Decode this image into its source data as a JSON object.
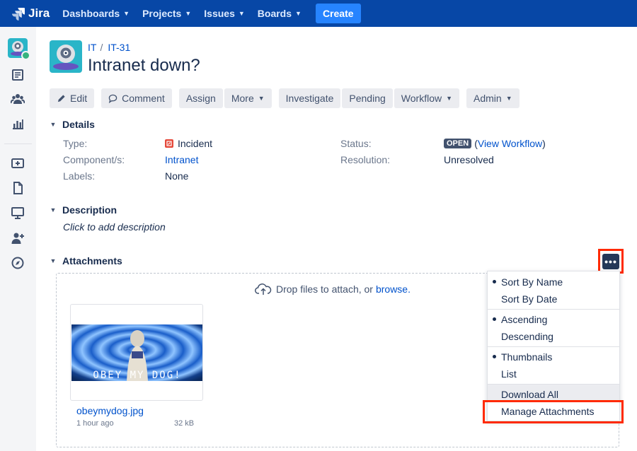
{
  "topnav": {
    "logo_text": "Jira",
    "items": [
      {
        "label": "Dashboards"
      },
      {
        "label": "Projects"
      },
      {
        "label": "Issues"
      },
      {
        "label": "Boards"
      }
    ],
    "create_label": "Create"
  },
  "sidebar": {
    "icons": [
      "project-avatar",
      "backlog-icon",
      "team-icon",
      "reports-icon",
      "add-item-icon",
      "pages-icon",
      "monitor-icon",
      "add-people-icon",
      "compass-icon"
    ]
  },
  "breadcrumb": {
    "project": "IT",
    "issue_key": "IT-31"
  },
  "issue": {
    "title": "Intranet down?"
  },
  "toolbar": {
    "edit": "Edit",
    "comment": "Comment",
    "assign": "Assign",
    "more": "More",
    "investigate": "Investigate",
    "pending": "Pending",
    "workflow": "Workflow",
    "admin": "Admin"
  },
  "details": {
    "heading": "Details",
    "type_label": "Type:",
    "type_value": "Incident",
    "component_label": "Component/s:",
    "component_value": "Intranet",
    "labels_label": "Labels:",
    "labels_value": "None",
    "status_label": "Status:",
    "status_value": "OPEN",
    "view_workflow": "View Workflow",
    "resolution_label": "Resolution:",
    "resolution_value": "Unresolved"
  },
  "description": {
    "heading": "Description",
    "placeholder": "Click to add description"
  },
  "attachments": {
    "heading": "Attachments",
    "drop_text": "Drop files to attach, or ",
    "browse": "browse.",
    "file": {
      "name": "obeymydog.jpg",
      "age": "1 hour ago",
      "size": "32 kB",
      "caption": "OBEY MY DOG!"
    },
    "more_label": "•••"
  },
  "menu": {
    "sort_by_name": "Sort By Name",
    "sort_by_date": "Sort By Date",
    "ascending": "Ascending",
    "descending": "Descending",
    "thumbnails": "Thumbnails",
    "list": "List",
    "download_all": "Download All",
    "manage": "Manage Attachments"
  },
  "colors": {
    "nav": "#0747a6",
    "accent": "#0052cc",
    "highlight": "#ff2a00"
  }
}
